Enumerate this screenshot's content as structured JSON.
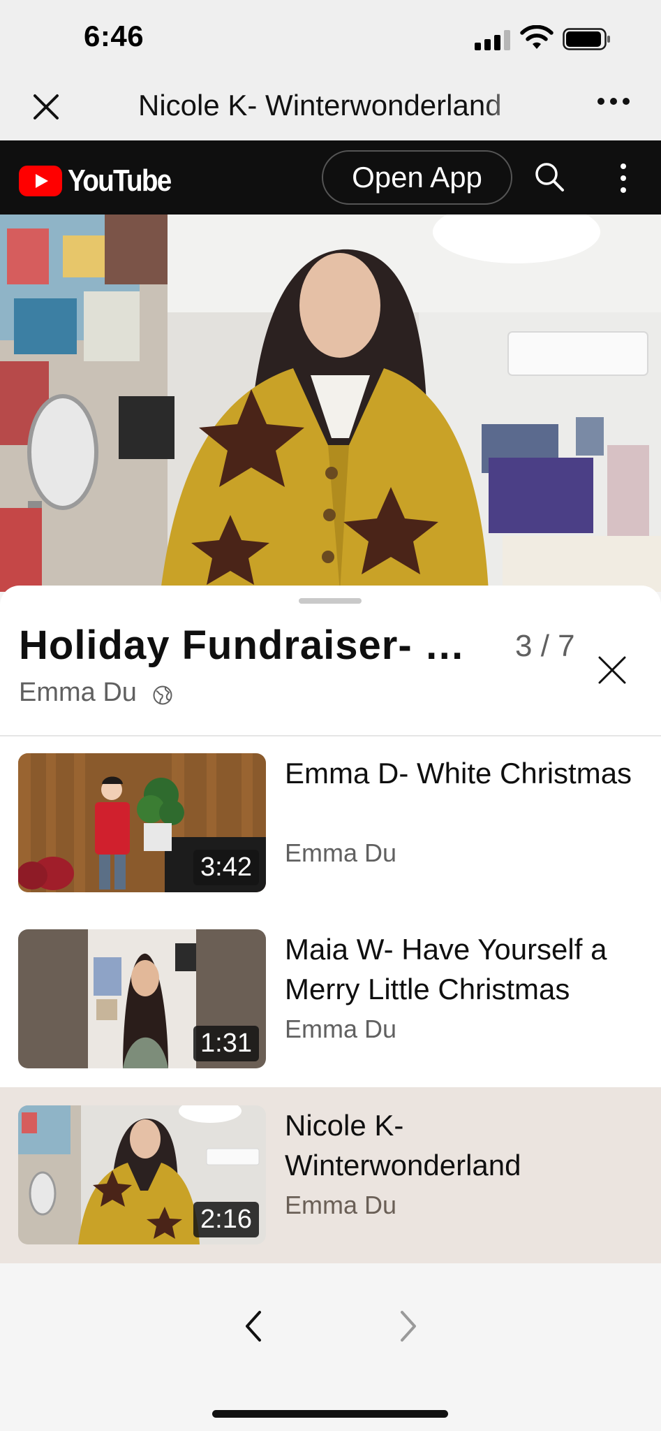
{
  "status": {
    "time": "6:46",
    "icons": [
      "cellular-signal-icon",
      "wifi-icon",
      "battery-icon"
    ]
  },
  "browser": {
    "title": "Nicole K- Winterwonderland",
    "icons": [
      "close-icon",
      "more-icon"
    ]
  },
  "youtube": {
    "logo_text": "YouTube",
    "open_app_label": "Open App",
    "icons": [
      "search-icon",
      "kebab-menu-icon"
    ],
    "brand_color": "#ff0000"
  },
  "playlist": {
    "title": "Holiday Fundraiser- …",
    "position": "3 / 7",
    "owner": "Emma Du",
    "visibility_icon": "globe-icon",
    "items": [
      {
        "title": "Emma D- White Christmas",
        "channel": "Emma Du",
        "duration": "3:42",
        "active": false
      },
      {
        "title": "Maia W- Have Yourself a Merry Little Christmas",
        "channel": "Emma Du",
        "duration": "1:31",
        "active": false
      },
      {
        "title": "Nicole K- Winterwonderland",
        "channel": "Emma Du",
        "duration": "2:16",
        "active": true
      }
    ]
  },
  "navigation": {
    "icons": [
      "chevron-left-icon",
      "chevron-right-icon"
    ]
  }
}
